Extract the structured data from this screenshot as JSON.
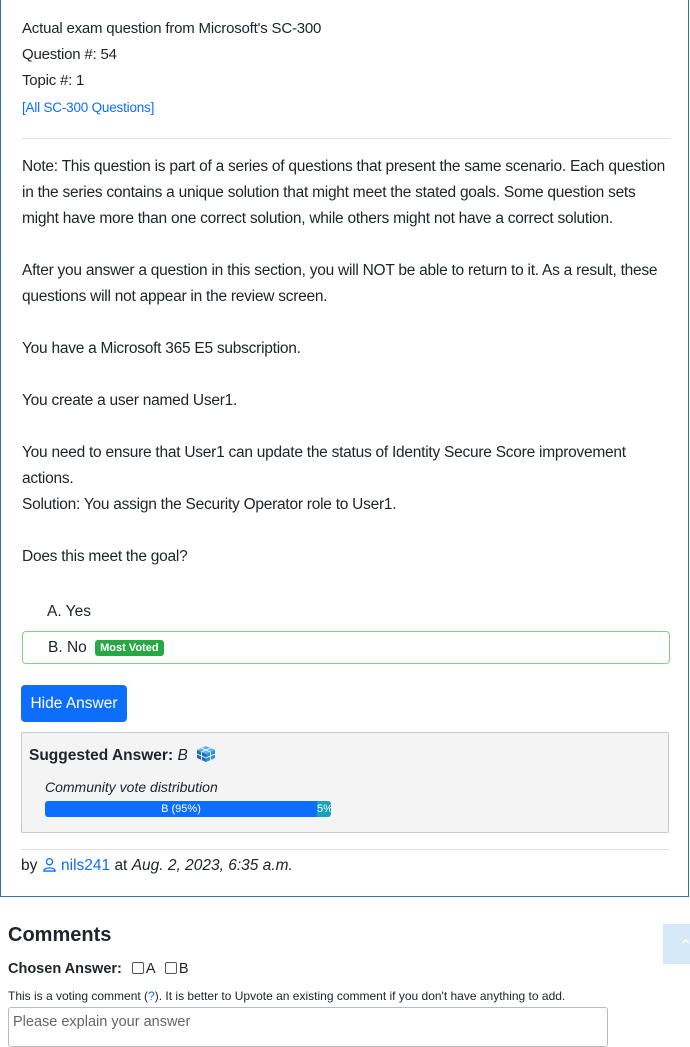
{
  "header": {
    "exam_line": "Actual exam question from Microsoft's SC-300",
    "question_number": "Question #: 54",
    "topic": "Topic #: 1",
    "all_questions_link": "[All SC-300 Questions]"
  },
  "question": {
    "paragraphs": [
      "Note: This question is part of a series of questions that present the same scenario. Each question in the series contains a unique solution that might meet the stated goals. Some question sets might have more than one correct solution, while others might not have a correct solution.",
      "After you answer a question in this section, you will NOT be able to return to it. As a result, these questions will not appear in the review screen.",
      "You have a Microsoft 365 E5 subscription.",
      "You create a user named User1.",
      "You need to ensure that User1 can update the status of Identity Secure Score improvement actions.",
      "Solution: You assign the Security Operator role to User1.",
      "Does this meet the goal?"
    ],
    "choices": [
      {
        "label": "A. Yes",
        "badge": ""
      },
      {
        "label": "B. No",
        "badge": "Most Voted"
      }
    ]
  },
  "hide_answer_button": "Hide Answer",
  "answer": {
    "suggested_label": "Suggested Answer:",
    "suggested_value": "B",
    "vote_title": "Community vote distribution",
    "vote_b_label": "B (95%)",
    "vote_other_label": "5%",
    "vote_b_fraction": 0.95,
    "vote_other_fraction": 0.05
  },
  "byline": {
    "by": "by",
    "user": "nils241",
    "at": "at",
    "date": "Aug. 2, 2023, 6:35 a.m."
  },
  "comments": {
    "title": "Comments",
    "chosen_label": "Chosen Answer:",
    "option_a": "A",
    "option_b": "B",
    "note_before": "This is a voting comment (",
    "note_q": "?",
    "note_after": "). It is better to Upvote an existing comment if you don't have anything to add.",
    "textarea_placeholder": "Please explain your answer"
  },
  "colors": {
    "accent": "#0d6efd",
    "badge_green": "#28a745",
    "vote_other": "#17a2b8"
  }
}
